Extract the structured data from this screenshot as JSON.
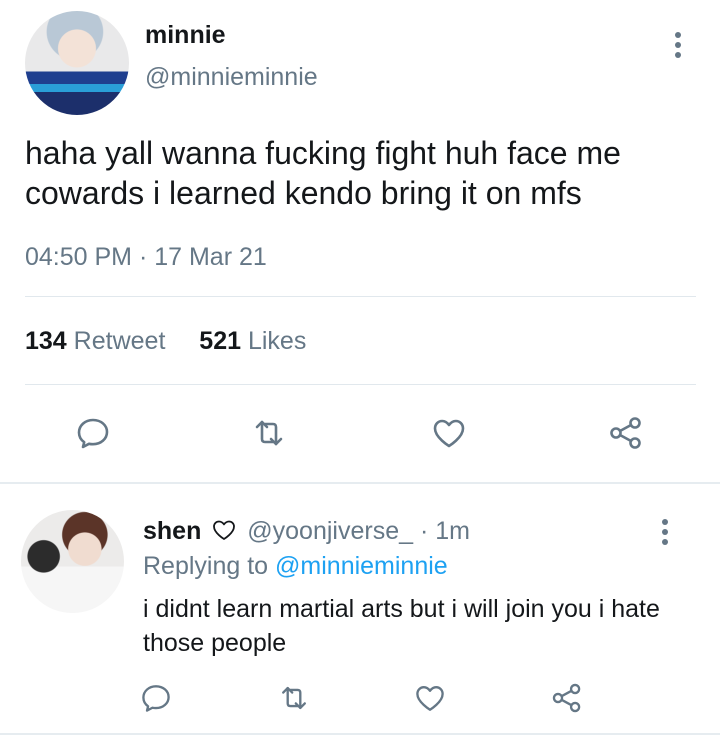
{
  "main_tweet": {
    "display_name": "minnie",
    "handle": "@minnieminnie",
    "text": "haha yall wanna fucking fight huh face me cowards i learned kendo bring it on mfs",
    "timestamp": "04:50 PM · 17 Mar 21",
    "retweet_count": "134",
    "retweet_label": "Retweet",
    "like_count": "521",
    "like_label": "Likes"
  },
  "reply": {
    "display_name": "shen",
    "handle_and_time": "@yoonjiverse_ · 1m",
    "replying_label": "Replying to",
    "replying_handle": "@minnieminnie",
    "text": "i didnt learn martial arts but i will join you i hate those people"
  },
  "icons": {
    "reply": "reply-icon",
    "retweet": "retweet-icon",
    "like": "heart-icon",
    "share": "share-icon",
    "more": "more-vertical-icon"
  },
  "colors": {
    "text": "#14171a",
    "secondary": "#657786",
    "link": "#1da1f2",
    "divider": "#e1e8ed"
  }
}
